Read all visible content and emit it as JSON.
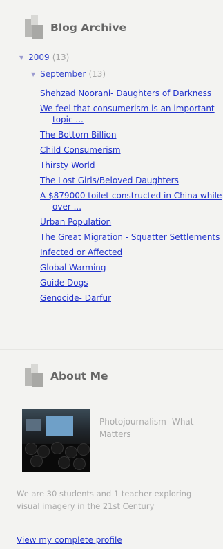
{
  "archive": {
    "title": "Blog Archive",
    "year": {
      "toggle": "▼",
      "label": "2009",
      "count": "(13)"
    },
    "month": {
      "toggle": "▼",
      "label": "September",
      "count": "(13)"
    },
    "posts": [
      "Shehzad Noorani- Daughters of Darkness",
      "We feel that consumerism is an important topic ...",
      "The Bottom Billion",
      "Child Consumerism",
      "Thirsty World",
      "The Lost Girls/Beloved Daughters",
      "A $879000 toilet constructed in China while over ...",
      "Urban Population",
      "The Great Migration - Squatter Settlements",
      "Infected or Affected",
      "Global Warming",
      "Guide Dogs",
      "Genocide- Darfur"
    ]
  },
  "about": {
    "title": "About Me",
    "profile_name": "Photojournalism- What Matters",
    "bio": "We are 30 students and 1 teacher exploring visual imagery in the 21st Century",
    "profile_link": "View my complete profile"
  }
}
